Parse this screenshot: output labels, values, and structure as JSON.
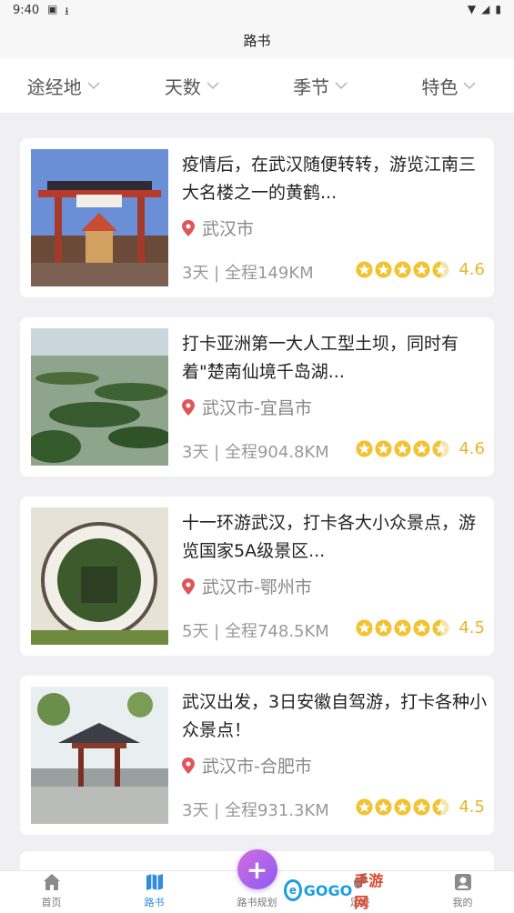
{
  "status_bar": {
    "time": "9:40",
    "left_icons": [
      "a-badge-icon",
      "download-icon"
    ],
    "right_icons": [
      "wifi-icon",
      "signal-icon",
      "battery-icon"
    ]
  },
  "title": "路书",
  "filters": [
    {
      "label": "途经地"
    },
    {
      "label": "天数"
    },
    {
      "label": "季节"
    },
    {
      "label": "特色"
    }
  ],
  "cards": [
    {
      "title": "疫情后，在武汉随便转转，游览江南三大名楼之一的黄鹤...",
      "location": "武汉市",
      "meta": "3天 | 全程149KM",
      "stars": 4.5,
      "score": "4.6",
      "image": "gate-and-tower-photo"
    },
    {
      "title": "打卡亚洲第一大人工型土坝，同时有着\"楚南仙境千岛湖...",
      "location": "武汉市-宜昌市",
      "meta": "3天 | 全程904.8KM",
      "stars": 4.5,
      "score": "4.6",
      "image": "lake-islands-photo"
    },
    {
      "title": "十一环游武汉，打卡各大小众景点，游览国家5A级景区...",
      "location": "武汉市-鄂州市",
      "meta": "5天 | 全程748.5KM",
      "stars": 4.5,
      "score": "4.5",
      "image": "moon-gate-photo"
    },
    {
      "title": "武汉出发，3日安徽自驾游，打卡各种小众景点！",
      "location": "武汉市-合肥市",
      "meta": "3天 | 全程931.3KM",
      "stars": 4.5,
      "score": "4.5",
      "image": "pavilion-bridge-photo"
    }
  ],
  "tabs": [
    {
      "label": "首页",
      "icon": "home-icon",
      "active": false
    },
    {
      "label": "路书",
      "icon": "map-icon",
      "active": true
    },
    {
      "label": "路书规划",
      "icon": "plus-icon",
      "active": false
    },
    {
      "label": "足迹",
      "icon": "footprint-icon",
      "active": false
    },
    {
      "label": "我的",
      "icon": "profile-icon",
      "active": false
    }
  ],
  "fab_label": "+",
  "watermark": {
    "brand": "GOGO",
    "sub": "手游网"
  },
  "colors": {
    "accent": "#2f8cde",
    "star": "#f2c230",
    "score": "#e8b52a",
    "fab": "#a866e8",
    "pin": "#e0555a"
  }
}
